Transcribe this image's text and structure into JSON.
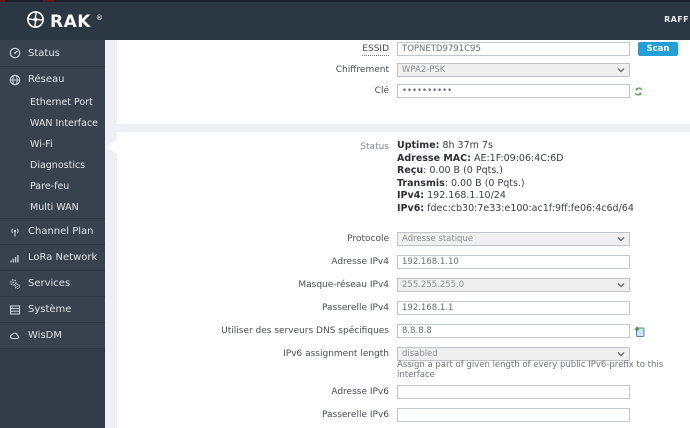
{
  "header": {
    "brand": "RAK",
    "reg": "®",
    "right_text": "RAFF"
  },
  "sidebar": {
    "active_item": "Wi-Fi",
    "items": [
      {
        "label": "Status",
        "icon": "gauge-icon"
      },
      {
        "label": "Réseau",
        "icon": "globe-icon"
      },
      {
        "label": "Channel Plan",
        "icon": "antenna-icon"
      },
      {
        "label": "LoRa Network",
        "icon": "signal-icon"
      },
      {
        "label": "Services",
        "icon": "gears-icon"
      },
      {
        "label": "Système",
        "icon": "server-icon"
      },
      {
        "label": "WisDM",
        "icon": "cloud-icon"
      }
    ],
    "reseau_children": [
      "Ethernet Port",
      "WAN Interface",
      "Wi-Fi",
      "Diagnostics",
      "Pare-feu",
      "Multi WAN"
    ]
  },
  "wifi_section": {
    "essid_label": "ESSID",
    "essid_value": "TOPNETD9791C95",
    "scan_label": "Scan",
    "encryption_label": "Chiffrement",
    "encryption_value": "WPA2-PSK",
    "key_label": "Clé",
    "key_value": "••••••••••"
  },
  "status_section": {
    "label": "Status",
    "lines": [
      {
        "b": "Uptime:",
        "t": " 8h 37m 7s"
      },
      {
        "b": "Adresse MAC:",
        "t": " AE:1F:09:06:4C:6D"
      },
      {
        "b": "Reçu",
        "t": ": 0.00 B (0 Pqts.)"
      },
      {
        "b": "Transmis",
        "t": ": 0.00 B (0 Pqts.)"
      },
      {
        "b": "IPv4:",
        "t": " 192.168.1.10/24"
      },
      {
        "b": "IPv6:",
        "t": " fdec:cb30:7e33:e100:ac1f:9ff:fe06:4c6d/64"
      }
    ]
  },
  "form": {
    "protocol_label": "Protocole",
    "protocol_value": "Adresse statique",
    "ipv4_address_label": "Adresse IPv4",
    "ipv4_address_value": "192.168.1.10",
    "ipv4_netmask_label": "Masque-réseau IPv4",
    "ipv4_netmask_value": "255.255.255.0",
    "ipv4_gateway_label": "Passerelle IPv4",
    "ipv4_gateway_value": "192.168.1.1",
    "dns_label": "Utiliser des serveurs DNS spécifiques",
    "dns_value": "8.8.8.8",
    "ipv6_assign_label": "IPv6 assignment length",
    "ipv6_assign_value": "disabled",
    "ipv6_assign_hint": "Assign a part of given length of every public IPv6-prefix to this interface",
    "ipv6_address_label": "Adresse IPv6",
    "ipv6_address_value": "",
    "ipv6_gateway_label": "Passerelle IPv6",
    "ipv6_gateway_value": ""
  },
  "colors": {
    "header_bg": "#2c3744",
    "sidebar_bg": "#323c49",
    "accent_blue": "#219fd9",
    "page_bg": "#edf0f4",
    "icon_green": "#55a944"
  }
}
